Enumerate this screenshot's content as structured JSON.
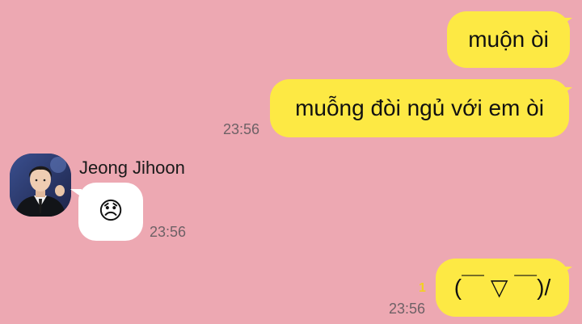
{
  "messages": [
    {
      "direction": "out",
      "text": "muộn òi"
    },
    {
      "direction": "out",
      "text": "muỗng đòi ngủ với em òi",
      "time": "23:56"
    },
    {
      "direction": "in",
      "sender": "Jeong Jihoon",
      "text": "😞",
      "emoji_name": "disappointed-face",
      "time": "23:56"
    },
    {
      "direction": "out",
      "text": "(￣ ▽ ￣)/",
      "time": "23:56",
      "unread": "1"
    }
  ],
  "colors": {
    "background": "#eda8b2",
    "outgoing_bubble": "#fde944",
    "incoming_bubble": "#ffffff",
    "unread_count": "#f2d021"
  }
}
